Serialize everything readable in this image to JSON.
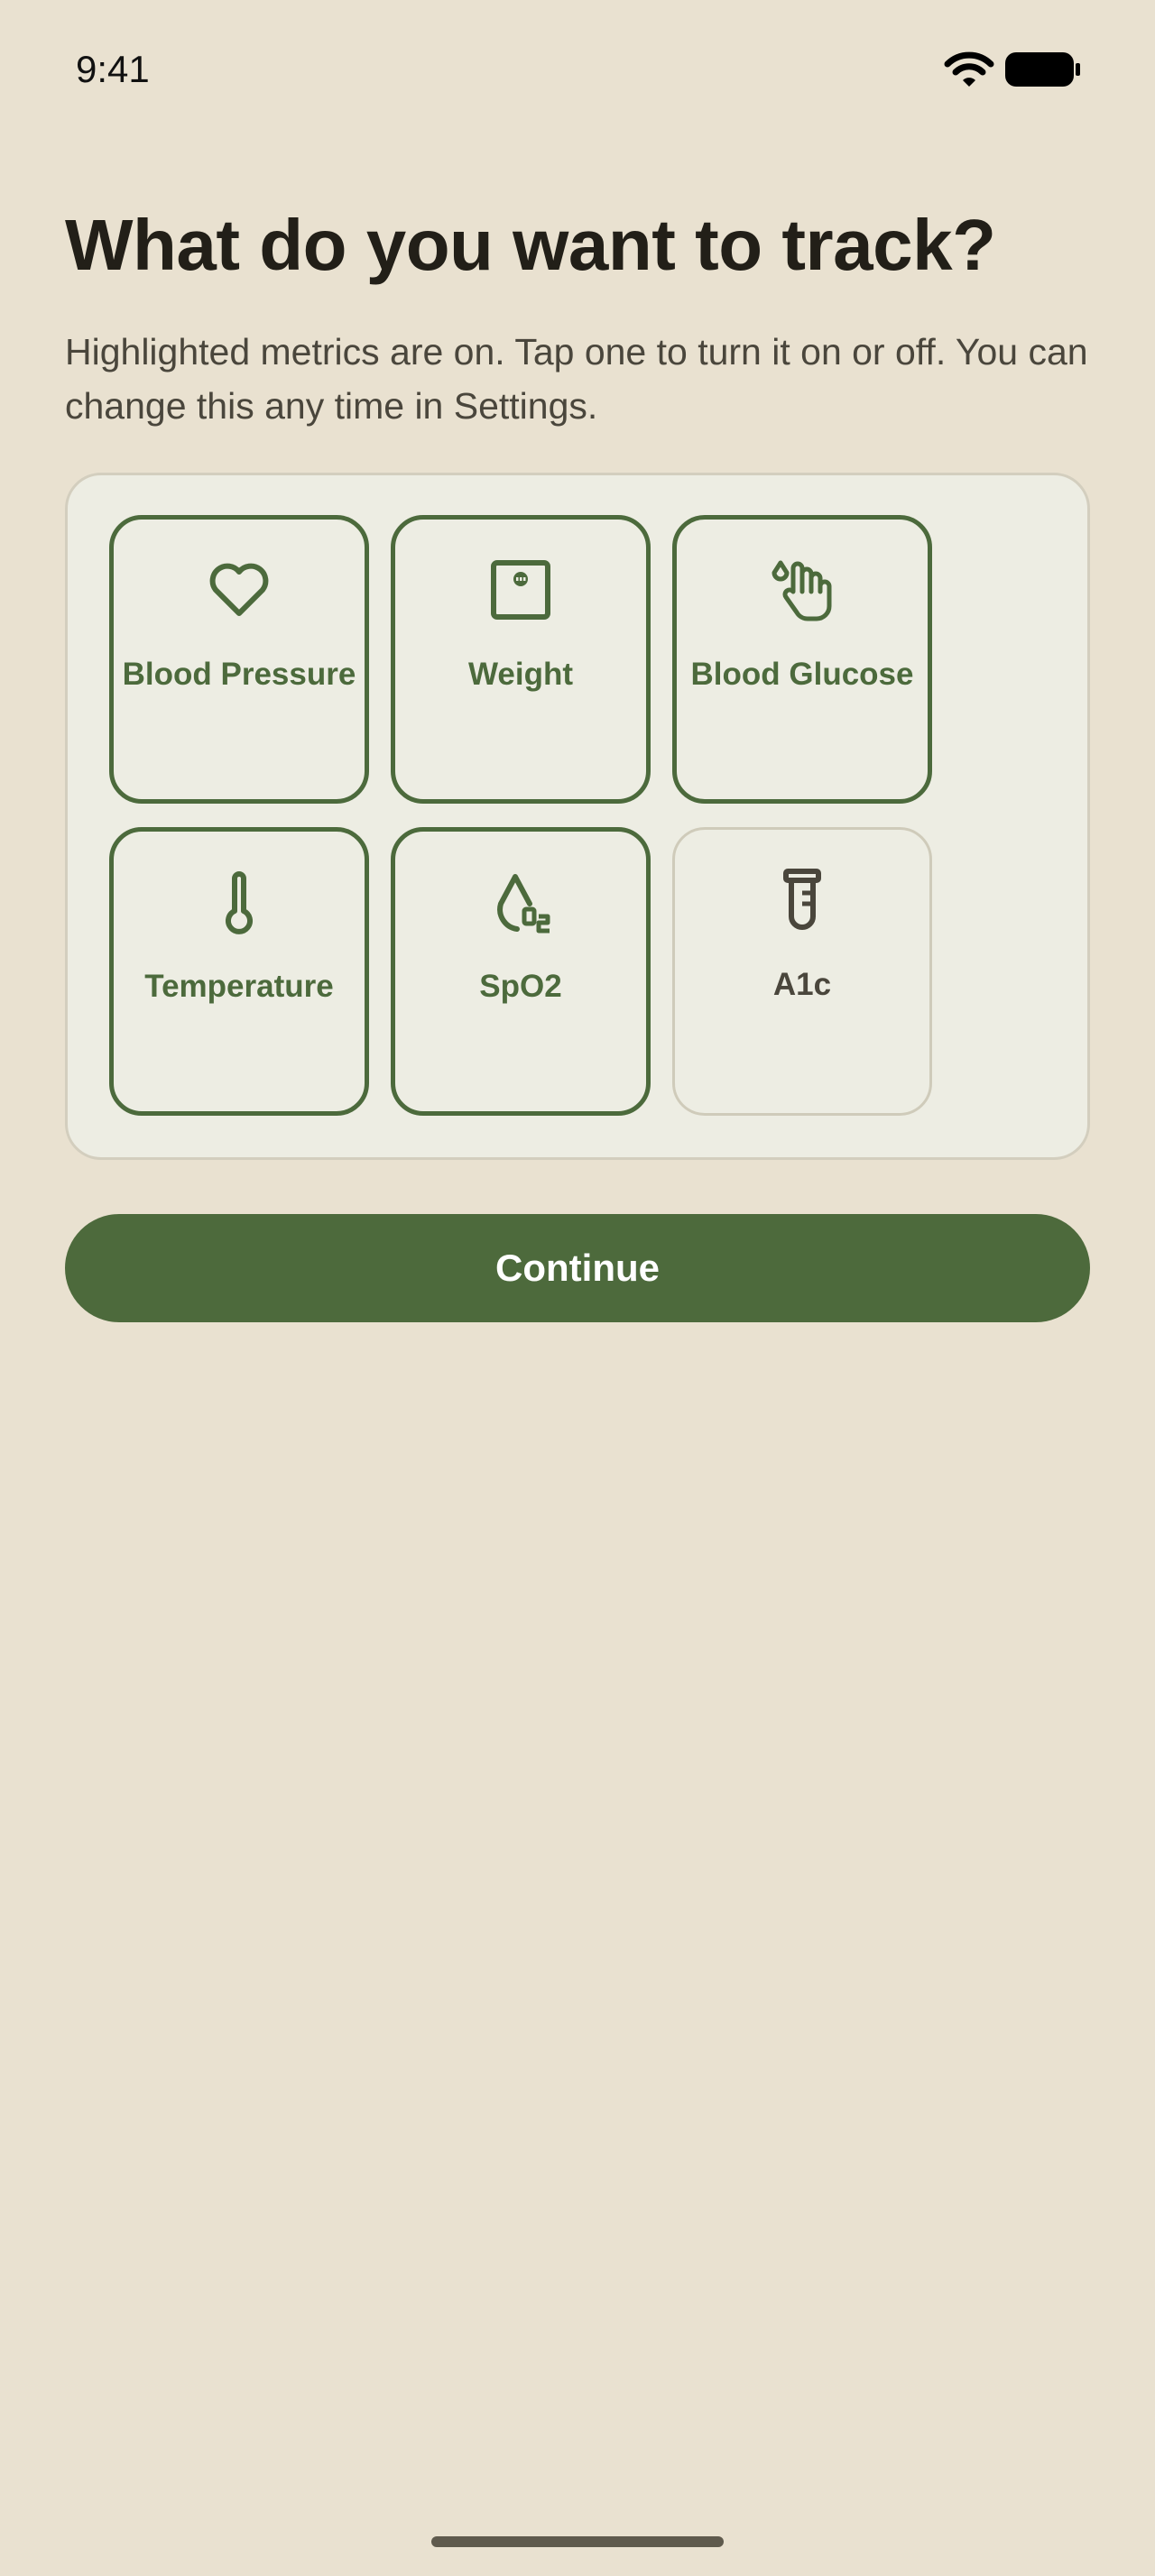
{
  "status_bar": {
    "time": "9:41",
    "icons": [
      "wifi-icon",
      "battery-icon"
    ]
  },
  "header": {
    "title": "What do you want to track?",
    "subtitle": "Highlighted metrics are on. Tap one to turn it on or off. You can change this any time in Settings."
  },
  "metrics": [
    {
      "label": "Blood Pressure",
      "icon": "heart-icon",
      "enabled": true
    },
    {
      "label": "Weight",
      "icon": "scale-icon",
      "enabled": true
    },
    {
      "label": "Blood Glucose",
      "icon": "glucose-finger-icon",
      "enabled": true
    },
    {
      "label": "Temperature",
      "icon": "thermometer-icon",
      "enabled": true
    },
    {
      "label": "SpO2",
      "icon": "oxygen-drop-icon",
      "enabled": true
    },
    {
      "label": "A1c",
      "icon": "test-tube-icon",
      "enabled": false
    }
  ],
  "actions": {
    "continue_label": "Continue"
  },
  "colors": {
    "background": "#e9e1d0",
    "panel": "#edede3",
    "accent": "#4d6a3c",
    "text": "#221f18"
  }
}
